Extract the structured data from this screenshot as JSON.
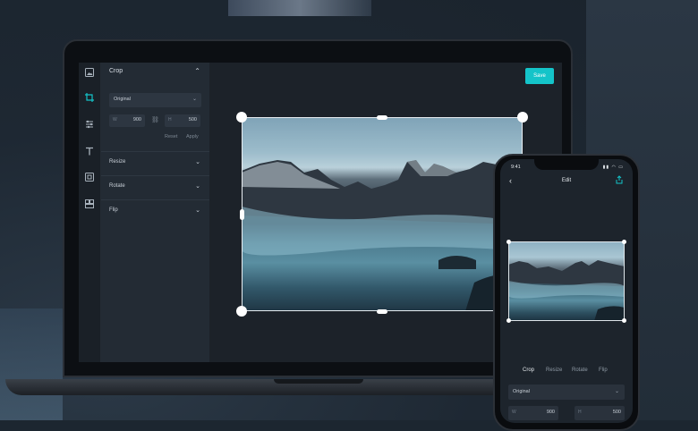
{
  "editor": {
    "panel": {
      "title": "Crop",
      "aspect_select": "Original",
      "width_label": "W",
      "width_value": "900",
      "height_label": "H",
      "height_value": "500",
      "reset_label": "Reset",
      "apply_label": "Apply",
      "sections": [
        "Resize",
        "Rotate",
        "Flip"
      ]
    },
    "save_label": "Save",
    "tools": [
      "image-icon",
      "crop-icon",
      "adjust-icon",
      "text-icon",
      "frame-icon",
      "collage-icon"
    ]
  },
  "phone": {
    "time": "9:41",
    "title": "Edit",
    "tabs": [
      "Crop",
      "Resize",
      "Rotate",
      "Flip"
    ],
    "active_tab": "Crop",
    "aspect_select": "Original",
    "width_label": "W",
    "width_value": "900",
    "height_label": "H",
    "height_value": "500"
  },
  "colors": {
    "accent": "#14c4c9",
    "panel": "#232b34",
    "canvas": "#1c2229"
  }
}
